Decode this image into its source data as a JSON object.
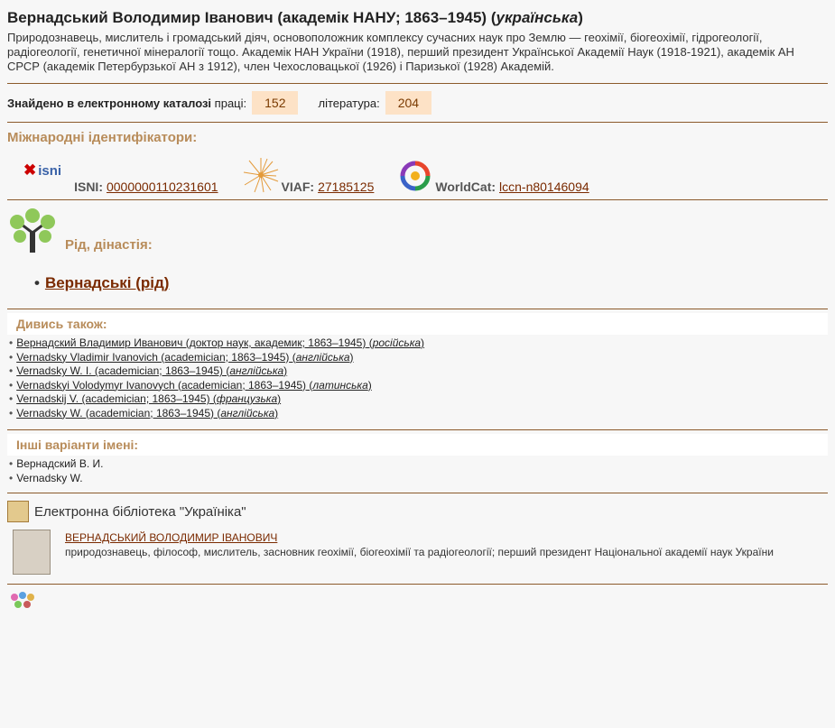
{
  "header": {
    "name": "Вернадський Володимир Іванович (академік НАНУ; 1863–1945) (",
    "lang": "українська",
    "close": ")",
    "description": "Природознавець, мислитель і громадський діяч, основоположник комплексу сучасних наук про Землю — геохімії, біогеохімії, гідрогеології, радіогеології, генетичної мінералогії тощо. Академік НАН України (1918), перший президент Української Академії Наук (1918-1921), академік АН СРСР (академік Петербурзької АН з 1912), член Чехословацької (1926) і Паризької (1928) Академій."
  },
  "catalog": {
    "label": "Знайдено в електронному каталозі",
    "works_label": "праці:",
    "works_count": "152",
    "lit_label": "література:",
    "lit_count": "204"
  },
  "identifiers": {
    "heading": "Міжнародні ідентифікатори:",
    "isni_logo": "isni",
    "isni_label": "ISNI:",
    "isni_value": "0000000110231601",
    "viaf_label": "VIAF:",
    "viaf_value": "27185125",
    "worldcat_label": "WorldCat:",
    "worldcat_value": "lccn-n80146094"
  },
  "dynasty": {
    "heading": "Рід, дінастія:",
    "link": "Вернадські (рід)"
  },
  "see_also": {
    "heading": "Дивись також:",
    "items": [
      {
        "text": "Вернадский Владимир Иванович (доктор наук, академик; 1863–1945)",
        "lang": "російська"
      },
      {
        "text": "Vernadsky Vladimir Ivanovich (academician; 1863–1945)",
        "lang": "англійська"
      },
      {
        "text": "Vernadsky W. I. (academician; 1863–1945)",
        "lang": "англійська"
      },
      {
        "text": "Vernadskyi Volodymyr Ivanovych (academician; 1863–1945)",
        "lang": "латинська"
      },
      {
        "text": "Vernadskij V. (academician; 1863–1945)",
        "lang": "французька"
      },
      {
        "text": "Vernadsky W. (academician; 1863–1945)",
        "lang": "англійська"
      }
    ]
  },
  "other_names": {
    "heading": "Інші варіанти імені:",
    "items": [
      "Вернадский В. И.",
      "Vernadsky W."
    ]
  },
  "library": {
    "title": "Електронна бібліотека \"Україніка\"",
    "entry_title": "ВЕРНАДСЬКИЙ ВОЛОДИМИР ІВАНОВИЧ",
    "entry_desc": "природознавець, філософ, мислитель, засновник геохімії, біогеохімії та радіогеології; перший президент Національної академії наук України"
  },
  "colors": {
    "accent": "#b88c5a",
    "link": "#7a2a00",
    "pill": "#fde2c6",
    "separator": "#8b5a2b"
  }
}
